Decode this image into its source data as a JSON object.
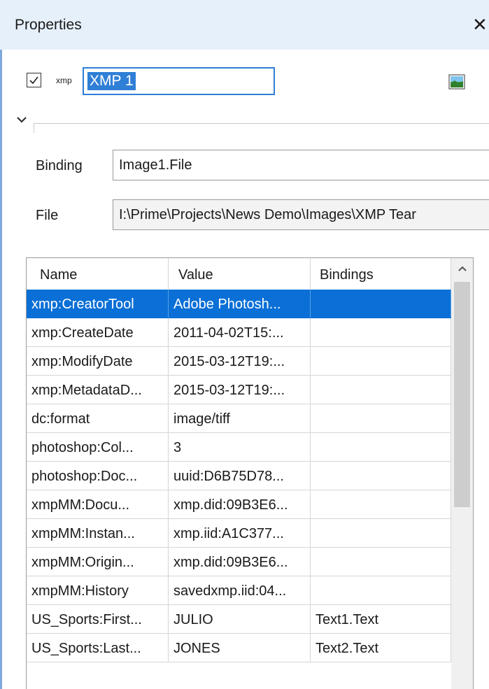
{
  "panel": {
    "title": "Properties",
    "close_glyph": "✕"
  },
  "header": {
    "enabled": true,
    "type_tag": "xmp",
    "name_value": "XMP 1",
    "image_icon": "image-icon"
  },
  "fields": {
    "binding_label": "Binding",
    "binding_value": "Image1.File",
    "file_label": "File",
    "file_value": "I:\\Prime\\Projects\\News Demo\\Images\\XMP Tear"
  },
  "table": {
    "columns": [
      "Name",
      "Value",
      "Bindings"
    ],
    "selected_row": 0,
    "rows": [
      {
        "name": "xmp:CreatorTool",
        "value": "Adobe Photosh...",
        "bindings": ""
      },
      {
        "name": "xmp:CreateDate",
        "value": "2011-04-02T15:...",
        "bindings": ""
      },
      {
        "name": "xmp:ModifyDate",
        "value": "2015-03-12T19:...",
        "bindings": ""
      },
      {
        "name": "xmp:MetadataD...",
        "value": "2015-03-12T19:...",
        "bindings": ""
      },
      {
        "name": "dc:format",
        "value": "image/tiff",
        "bindings": ""
      },
      {
        "name": "photoshop:Col...",
        "value": "3",
        "bindings": ""
      },
      {
        "name": "photoshop:Doc...",
        "value": "uuid:D6B75D78...",
        "bindings": ""
      },
      {
        "name": "xmpMM:Docu...",
        "value": "xmp.did:09B3E6...",
        "bindings": ""
      },
      {
        "name": "xmpMM:Instan...",
        "value": "xmp.iid:A1C377...",
        "bindings": ""
      },
      {
        "name": "xmpMM:Origin...",
        "value": "xmp.did:09B3E6...",
        "bindings": ""
      },
      {
        "name": "xmpMM:History",
        "value": "savedxmp.iid:04...",
        "bindings": ""
      },
      {
        "name": "US_Sports:First...",
        "value": "JULIO",
        "bindings": "Text1.Text"
      },
      {
        "name": "US_Sports:Last...",
        "value": "JONES",
        "bindings": "Text2.Text"
      }
    ]
  },
  "colors": {
    "selection": "#0a6fd6",
    "titlebar": "#e6f0fa",
    "focus_border": "#2f7fd6"
  }
}
